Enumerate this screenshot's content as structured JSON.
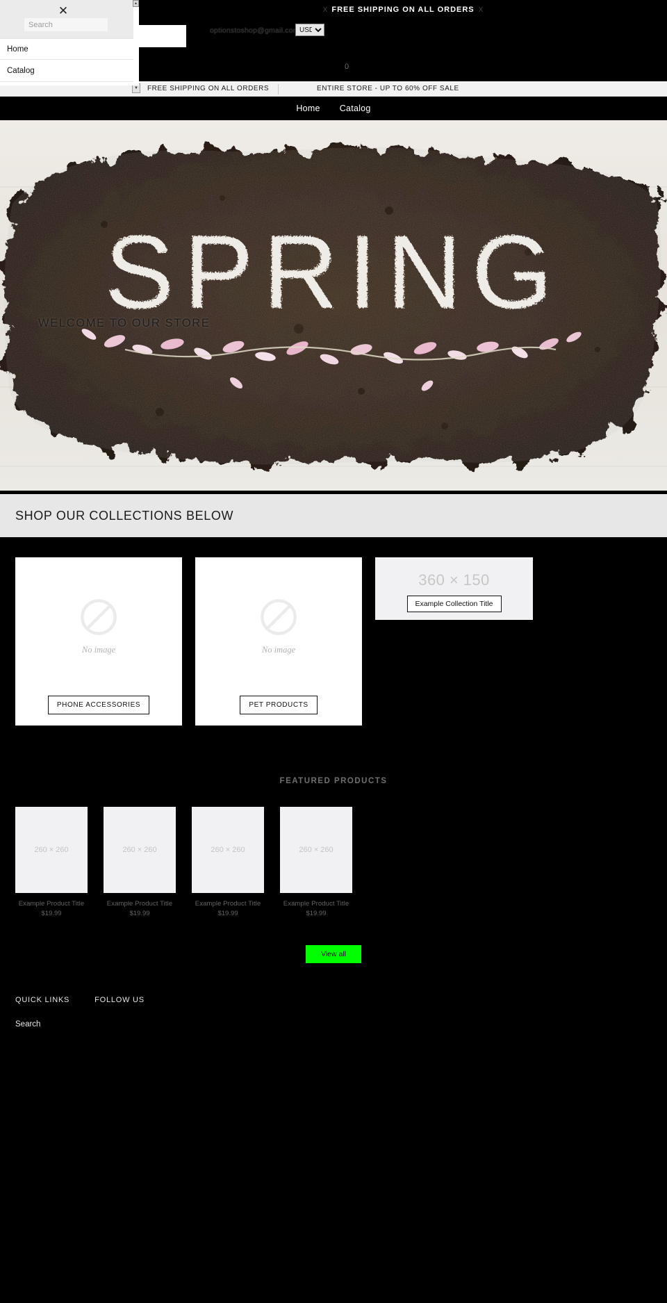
{
  "promo": {
    "text": "FREE SHIPPING ON ALL ORDERS",
    "decor_left": "X",
    "decor_right": "X"
  },
  "header": {
    "email": "optionstoshop@gmail.com",
    "currency_selected": "USD",
    "currency_options": [
      "USD"
    ],
    "cart_glyph": "0"
  },
  "announcement": {
    "items": [
      "FREE SHIPPING ON ALL ORDERS",
      "ENTIRE STORE - UP TO 60% OFF SALE"
    ],
    "scroll_arrow": "▼"
  },
  "nav": {
    "links": [
      {
        "label": "Home"
      },
      {
        "label": "Catalog"
      }
    ]
  },
  "hero": {
    "word": "SPRING",
    "caption": "WELCOME TO OUR STORE"
  },
  "collections_section": {
    "heading": "SHOP OUR COLLECTIONS BELOW",
    "cards": [
      {
        "button_label": "PHONE ACCESSORIES",
        "placeholder_label": "No image",
        "icon": "no-image-icon"
      },
      {
        "button_label": "PET PRODUCTS",
        "placeholder_label": "No image",
        "icon": "no-image-icon"
      },
      {
        "button_label": "Example Collection Title",
        "placeholder_dimensions": "360 × 150"
      }
    ]
  },
  "featured": {
    "title": "FEATURED PRODUCTS",
    "products": [
      {
        "thumb": "260 × 260",
        "title": "Example Product Title",
        "price": "$19.99"
      },
      {
        "thumb": "260 × 260",
        "title": "Example Product Title",
        "price": "$19.99"
      },
      {
        "thumb": "260 × 260",
        "title": "Example Product Title",
        "price": "$19.99"
      },
      {
        "thumb": "260 × 260",
        "title": "Example Product Title",
        "price": "$19.99"
      }
    ],
    "view_all_label": "View all",
    "view_all_color": "#00ff00"
  },
  "footer": {
    "headings": [
      "QUICK LINKS",
      "FOLLOW US"
    ],
    "links": [
      {
        "label": "Search"
      }
    ]
  },
  "drawer": {
    "close_label": "✕",
    "search_placeholder": "Search",
    "search_value": "",
    "items": [
      {
        "label": "Home"
      },
      {
        "label": "Catalog"
      }
    ]
  },
  "colors": {
    "background": "#000000",
    "announcement_bg": "#f2f2f2",
    "grey_band": "#e7e7e7",
    "accent_button": "#00ff00"
  }
}
